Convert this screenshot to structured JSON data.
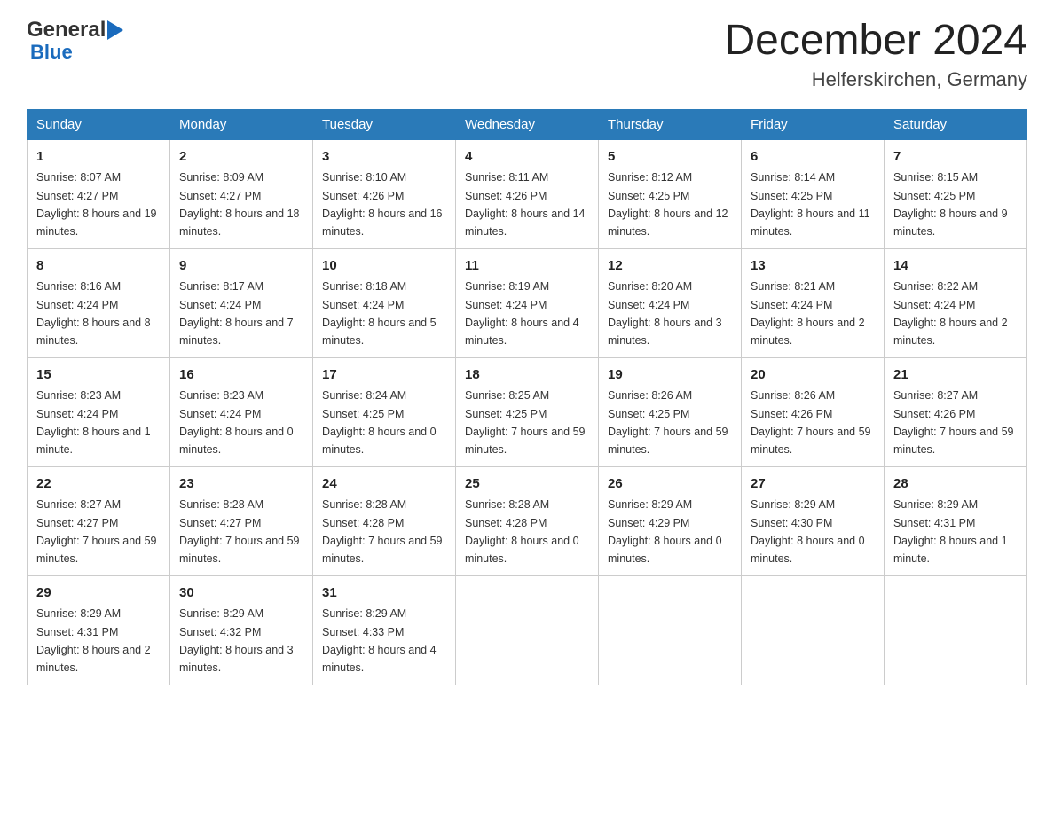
{
  "header": {
    "logo_general": "General",
    "logo_blue": "Blue",
    "month_title": "December 2024",
    "location": "Helferskirchen, Germany"
  },
  "days_of_week": [
    "Sunday",
    "Monday",
    "Tuesday",
    "Wednesday",
    "Thursday",
    "Friday",
    "Saturday"
  ],
  "weeks": [
    [
      {
        "day": "1",
        "sunrise": "8:07 AM",
        "sunset": "4:27 PM",
        "daylight": "8 hours and 19 minutes."
      },
      {
        "day": "2",
        "sunrise": "8:09 AM",
        "sunset": "4:27 PM",
        "daylight": "8 hours and 18 minutes."
      },
      {
        "day": "3",
        "sunrise": "8:10 AM",
        "sunset": "4:26 PM",
        "daylight": "8 hours and 16 minutes."
      },
      {
        "day": "4",
        "sunrise": "8:11 AM",
        "sunset": "4:26 PM",
        "daylight": "8 hours and 14 minutes."
      },
      {
        "day": "5",
        "sunrise": "8:12 AM",
        "sunset": "4:25 PM",
        "daylight": "8 hours and 12 minutes."
      },
      {
        "day": "6",
        "sunrise": "8:14 AM",
        "sunset": "4:25 PM",
        "daylight": "8 hours and 11 minutes."
      },
      {
        "day": "7",
        "sunrise": "8:15 AM",
        "sunset": "4:25 PM",
        "daylight": "8 hours and 9 minutes."
      }
    ],
    [
      {
        "day": "8",
        "sunrise": "8:16 AM",
        "sunset": "4:24 PM",
        "daylight": "8 hours and 8 minutes."
      },
      {
        "day": "9",
        "sunrise": "8:17 AM",
        "sunset": "4:24 PM",
        "daylight": "8 hours and 7 minutes."
      },
      {
        "day": "10",
        "sunrise": "8:18 AM",
        "sunset": "4:24 PM",
        "daylight": "8 hours and 5 minutes."
      },
      {
        "day": "11",
        "sunrise": "8:19 AM",
        "sunset": "4:24 PM",
        "daylight": "8 hours and 4 minutes."
      },
      {
        "day": "12",
        "sunrise": "8:20 AM",
        "sunset": "4:24 PM",
        "daylight": "8 hours and 3 minutes."
      },
      {
        "day": "13",
        "sunrise": "8:21 AM",
        "sunset": "4:24 PM",
        "daylight": "8 hours and 2 minutes."
      },
      {
        "day": "14",
        "sunrise": "8:22 AM",
        "sunset": "4:24 PM",
        "daylight": "8 hours and 2 minutes."
      }
    ],
    [
      {
        "day": "15",
        "sunrise": "8:23 AM",
        "sunset": "4:24 PM",
        "daylight": "8 hours and 1 minute."
      },
      {
        "day": "16",
        "sunrise": "8:23 AM",
        "sunset": "4:24 PM",
        "daylight": "8 hours and 0 minutes."
      },
      {
        "day": "17",
        "sunrise": "8:24 AM",
        "sunset": "4:25 PM",
        "daylight": "8 hours and 0 minutes."
      },
      {
        "day": "18",
        "sunrise": "8:25 AM",
        "sunset": "4:25 PM",
        "daylight": "7 hours and 59 minutes."
      },
      {
        "day": "19",
        "sunrise": "8:26 AM",
        "sunset": "4:25 PM",
        "daylight": "7 hours and 59 minutes."
      },
      {
        "day": "20",
        "sunrise": "8:26 AM",
        "sunset": "4:26 PM",
        "daylight": "7 hours and 59 minutes."
      },
      {
        "day": "21",
        "sunrise": "8:27 AM",
        "sunset": "4:26 PM",
        "daylight": "7 hours and 59 minutes."
      }
    ],
    [
      {
        "day": "22",
        "sunrise": "8:27 AM",
        "sunset": "4:27 PM",
        "daylight": "7 hours and 59 minutes."
      },
      {
        "day": "23",
        "sunrise": "8:28 AM",
        "sunset": "4:27 PM",
        "daylight": "7 hours and 59 minutes."
      },
      {
        "day": "24",
        "sunrise": "8:28 AM",
        "sunset": "4:28 PM",
        "daylight": "7 hours and 59 minutes."
      },
      {
        "day": "25",
        "sunrise": "8:28 AM",
        "sunset": "4:28 PM",
        "daylight": "8 hours and 0 minutes."
      },
      {
        "day": "26",
        "sunrise": "8:29 AM",
        "sunset": "4:29 PM",
        "daylight": "8 hours and 0 minutes."
      },
      {
        "day": "27",
        "sunrise": "8:29 AM",
        "sunset": "4:30 PM",
        "daylight": "8 hours and 0 minutes."
      },
      {
        "day": "28",
        "sunrise": "8:29 AM",
        "sunset": "4:31 PM",
        "daylight": "8 hours and 1 minute."
      }
    ],
    [
      {
        "day": "29",
        "sunrise": "8:29 AM",
        "sunset": "4:31 PM",
        "daylight": "8 hours and 2 minutes."
      },
      {
        "day": "30",
        "sunrise": "8:29 AM",
        "sunset": "4:32 PM",
        "daylight": "8 hours and 3 minutes."
      },
      {
        "day": "31",
        "sunrise": "8:29 AM",
        "sunset": "4:33 PM",
        "daylight": "8 hours and 4 minutes."
      },
      null,
      null,
      null,
      null
    ]
  ]
}
